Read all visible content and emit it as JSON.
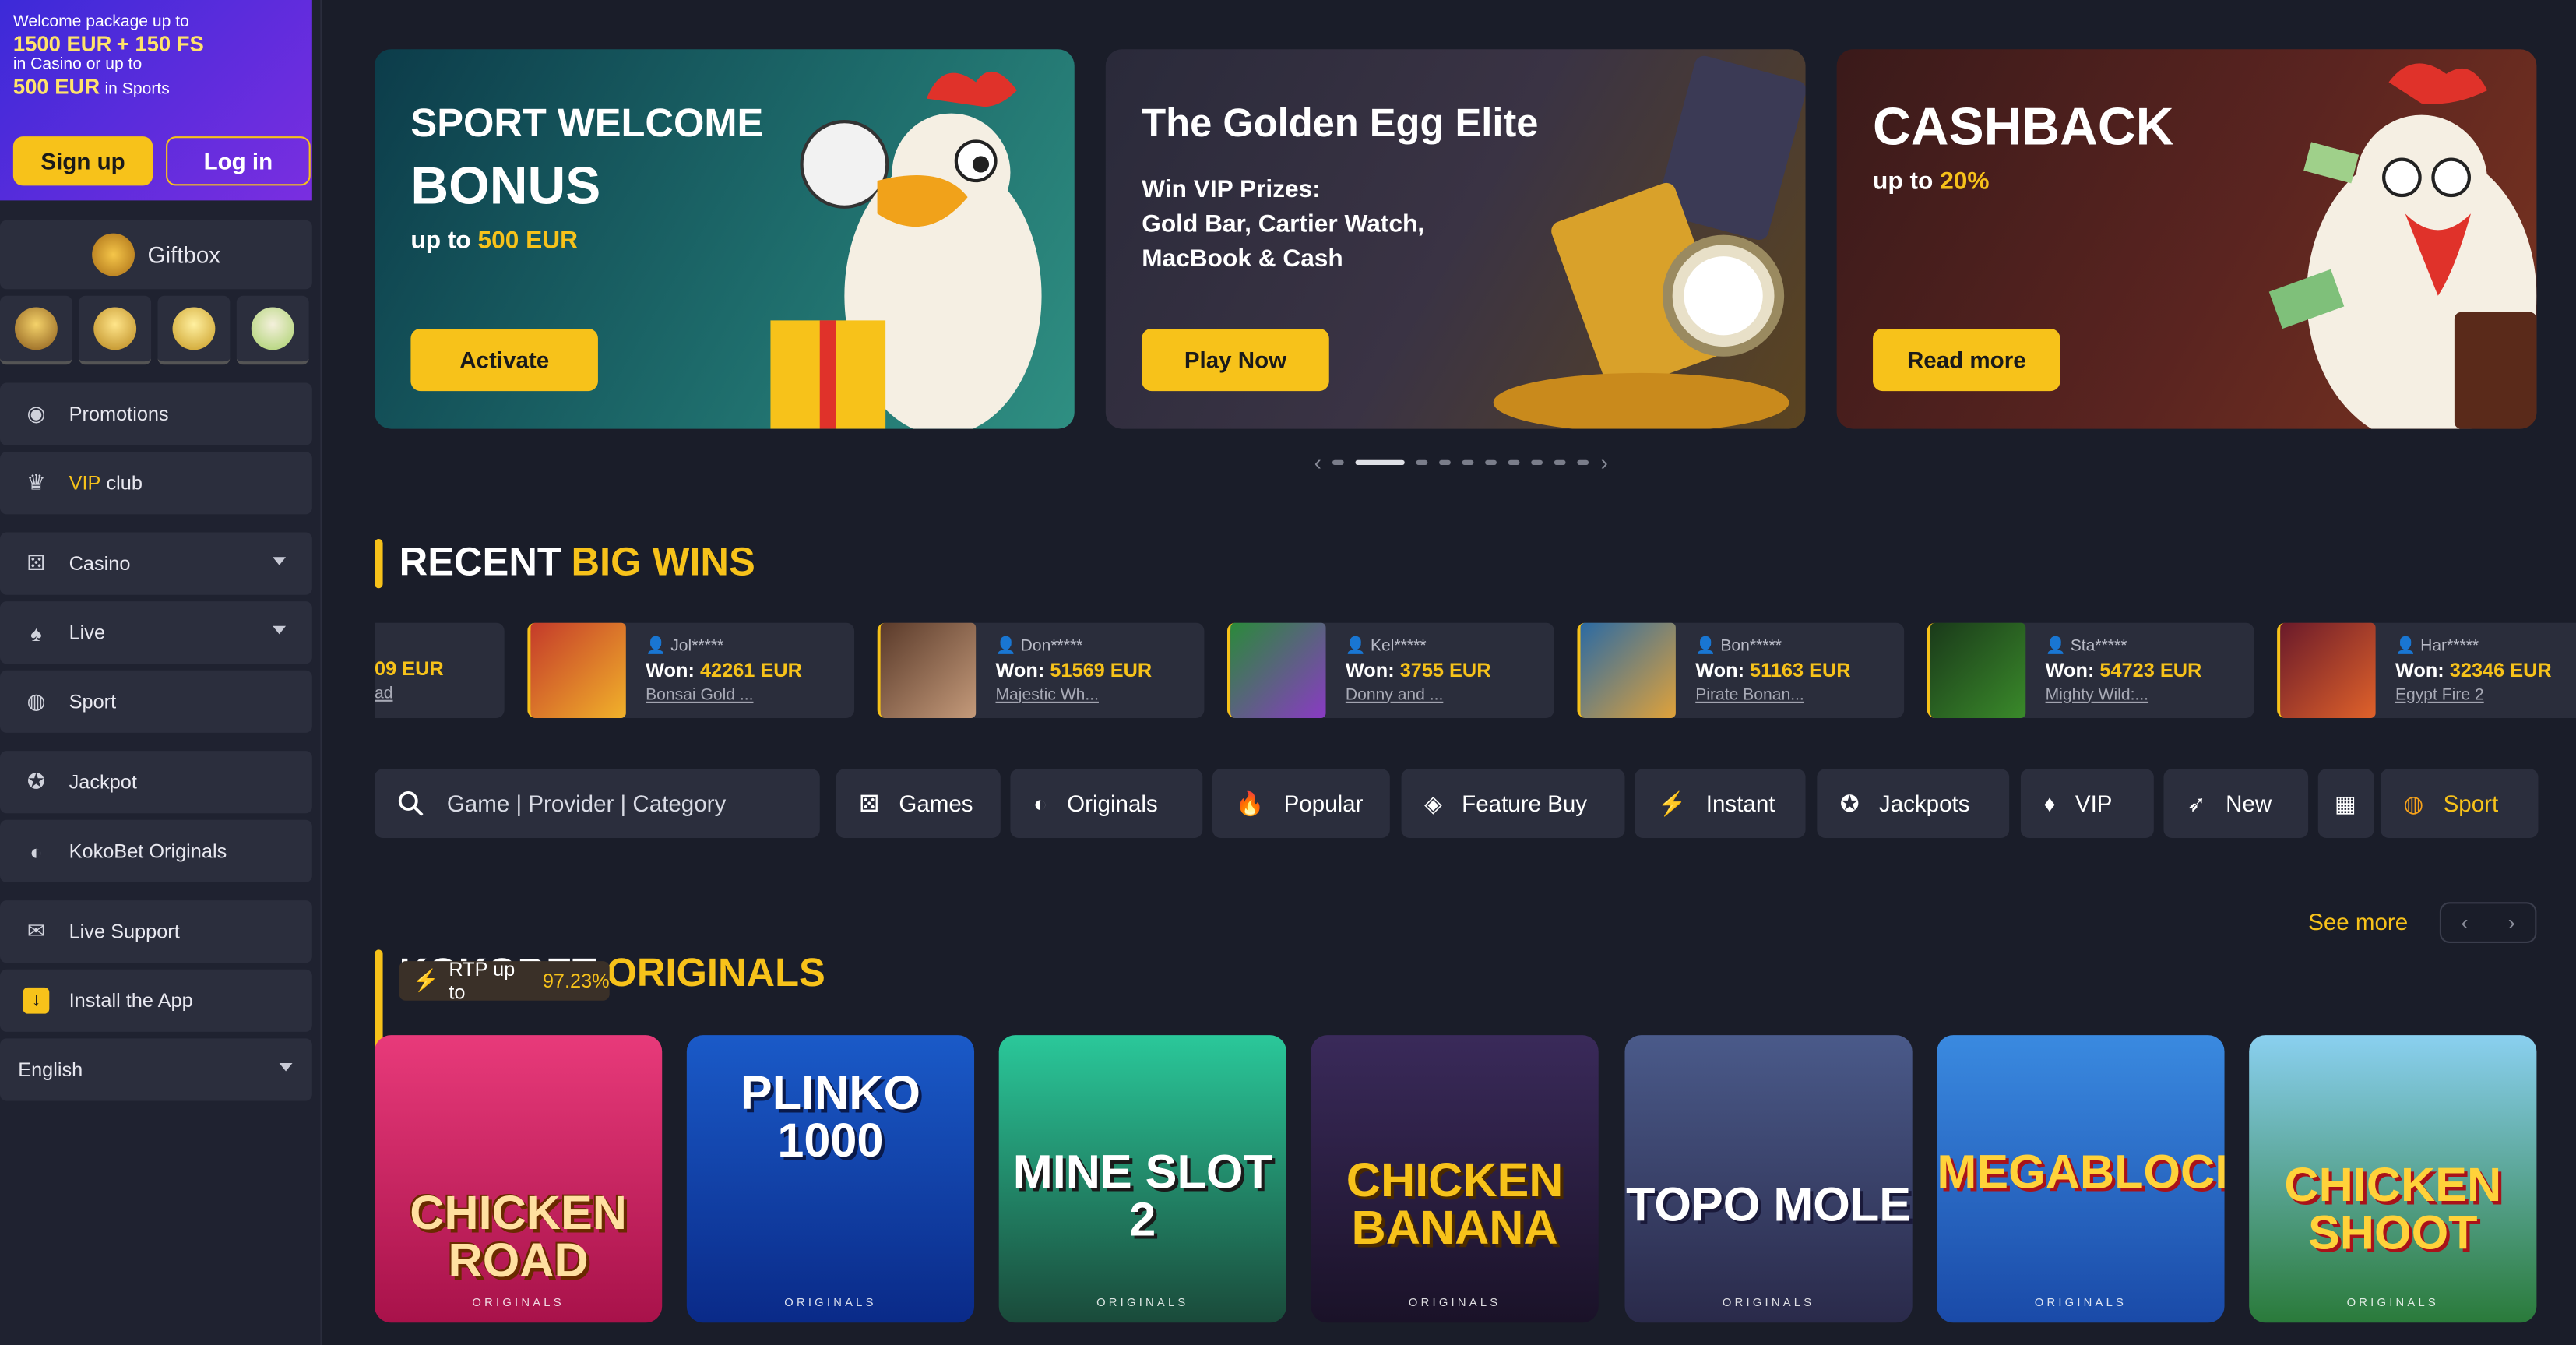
{
  "sidebar": {
    "welcome": {
      "line1": "Welcome package up to",
      "amount_casino": "1500 EUR",
      "plus_fs": "+ 150 FS",
      "line_casino": "in Casino or up to",
      "amount_sports": "500 EUR",
      "line_sports": "in Sports",
      "signup_label": "Sign up",
      "login_label": "Log in"
    },
    "giftbox_label": "Giftbox",
    "items": [
      {
        "label": "Promotions",
        "icon": "promotions-icon"
      },
      {
        "label": "VIP",
        "label_rest": " club",
        "icon": "crown-icon"
      },
      {
        "label": "Casino",
        "icon": "casino-icon"
      },
      {
        "label": "Live",
        "icon": "live-icon"
      },
      {
        "label": "Sport",
        "icon": "basketball-icon"
      },
      {
        "label": "Jackpot",
        "icon": "jackpot-icon"
      },
      {
        "label": "KokoBet Originals",
        "icon": "originals-icon"
      },
      {
        "label": "Live Support",
        "icon": "chat-icon"
      },
      {
        "label": "Install the App",
        "icon": "download-icon"
      }
    ],
    "language": "English"
  },
  "banners": [
    {
      "title_line1": "SPORT WELCOME",
      "title_line2": "BONUS",
      "sub_prefix": "up to ",
      "sub_amount": "500 EUR",
      "cta": "Activate"
    },
    {
      "title": "The Golden Egg Elite",
      "lines": [
        "Win VIP Prizes:",
        "Gold Bar, Cartier Watch,",
        "MacBook & Cash"
      ],
      "cta": "Play Now"
    },
    {
      "title": "CASHBACK",
      "sub_prefix": "up to ",
      "sub_amount": "20%",
      "cta": "Read more"
    }
  ],
  "carousel": {
    "page_count": 10,
    "active_index": 1
  },
  "recent_wins": {
    "title_white": "RECENT",
    "title_yellow": "BIG WINS",
    "partial": {
      "won_tail": "09 EUR",
      "game_tail": "ad"
    },
    "items": [
      {
        "user": "Jol*****",
        "won_label": "Won:",
        "amount": "42261 EUR",
        "game": "Bonsai Gold ..."
      },
      {
        "user": "Don*****",
        "won_label": "Won:",
        "amount": "51569 EUR",
        "game": "Majestic Wh..."
      },
      {
        "user": "Kel*****",
        "won_label": "Won:",
        "amount": "3755 EUR",
        "game": "Donny and ..."
      },
      {
        "user": "Bon*****",
        "won_label": "Won:",
        "amount": "51163 EUR",
        "game": "Pirate Bonan..."
      },
      {
        "user": "Sta*****",
        "won_label": "Won:",
        "amount": "54723 EUR",
        "game": "Mighty Wild:..."
      },
      {
        "user": "Har*****",
        "won_label": "Won:",
        "amount": "32346 EUR",
        "game": "Egypt Fire 2"
      }
    ]
  },
  "search": {
    "placeholder": "Game | Provider | Category"
  },
  "categories": [
    {
      "label": "Games"
    },
    {
      "label": "Originals"
    },
    {
      "label": "Popular"
    },
    {
      "label": "Feature Buy"
    },
    {
      "label": "Instant"
    },
    {
      "label": "Jackpots"
    },
    {
      "label": "VIP"
    },
    {
      "label": "New"
    },
    {
      "label": ""
    },
    {
      "label": "Sport"
    }
  ],
  "originals": {
    "title_white": "KOKOBET",
    "title_yellow": "ORIGINALS",
    "rtp_prefix": "RTP up to",
    "rtp_value": "97.23%",
    "see_more": "See more",
    "games": [
      {
        "title": "CHICKEN ROAD",
        "tag": "ORIGINALS"
      },
      {
        "title": "PLINKO 1000",
        "tag": "ORIGINALS"
      },
      {
        "title": "MINE SLOT 2",
        "tag": "ORIGINALS"
      },
      {
        "title": "CHICKEN BANANA",
        "tag": "ORIGINALS"
      },
      {
        "title": "TOPO MOLE",
        "tag": "ORIGINALS"
      },
      {
        "title": "MEGABLOCK",
        "tag": "ORIGINALS"
      },
      {
        "title": "CHICKEN SHOOT",
        "tag": "ORIGINALS"
      }
    ]
  },
  "colors": {
    "accent": "#f7c21a",
    "background": "#1a1d29",
    "panel": "#2b2e3d",
    "welcome_purple": "#5a2ee0"
  }
}
